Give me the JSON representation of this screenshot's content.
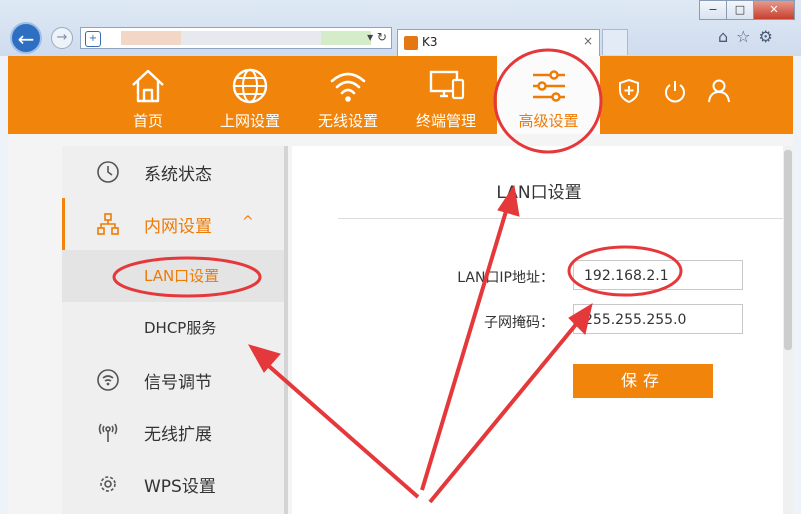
{
  "browser": {
    "window_controls": [
      "−",
      "□",
      "✕"
    ],
    "tab_title": "K3",
    "tab_close": "×",
    "address_tools": "▾ ↻"
  },
  "nav": {
    "items": [
      {
        "label": "首页",
        "icon": "home-icon"
      },
      {
        "label": "上网设置",
        "icon": "globe-icon"
      },
      {
        "label": "无线设置",
        "icon": "wifi-icon"
      },
      {
        "label": "终端管理",
        "icon": "devices-icon"
      },
      {
        "label": "高级设置",
        "icon": "sliders-icon",
        "active": true
      }
    ],
    "system_icons": [
      "shield-plus-icon",
      "power-icon",
      "user-icon"
    ]
  },
  "sidebar": {
    "items": [
      {
        "label": "系统状态",
        "icon": "clock-icon"
      },
      {
        "label": "内网设置",
        "icon": "network-icon",
        "expanded": true,
        "caret": "^"
      },
      {
        "label": "LAN口设置",
        "sub": true,
        "active": true
      },
      {
        "label": "DHCP服务",
        "sub": true
      },
      {
        "label": "信号调节",
        "icon": "signal-icon"
      },
      {
        "label": "无线扩展",
        "icon": "wireless-extend-icon"
      },
      {
        "label": "WPS设置",
        "icon": "wps-gear-icon"
      }
    ]
  },
  "main": {
    "title": "LAN口设置",
    "fields": [
      {
        "label": "LAN口IP地址：",
        "value": "192.168.2.1"
      },
      {
        "label": "子网掩码：",
        "value": "255.255.255.0"
      }
    ],
    "save_label": "保存"
  },
  "colors": {
    "accent": "#f1840b",
    "annotation": "#e5383b"
  }
}
